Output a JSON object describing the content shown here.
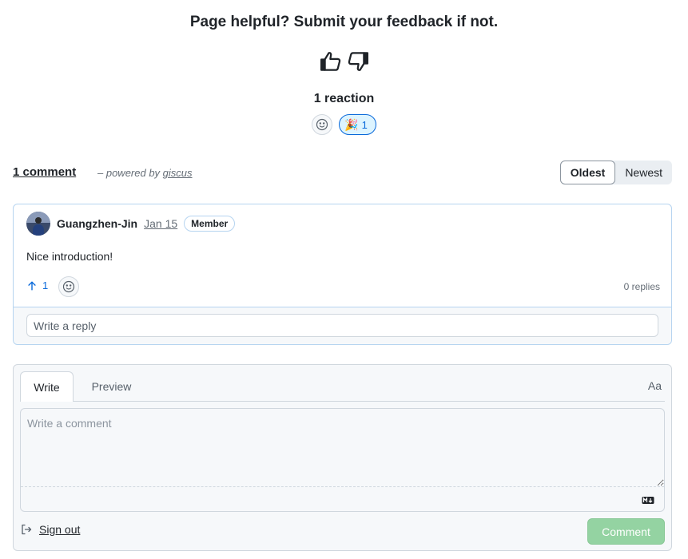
{
  "feedback": {
    "title": "Page helpful? Submit your feedback if not."
  },
  "reactions": {
    "count_label": "1 reaction",
    "tada_emoji": "🎉",
    "tada_count": "1"
  },
  "comments_header": {
    "count_label": "1 comment",
    "powered_prefix": " – powered by ",
    "powered_link": "giscus",
    "sort_options": [
      "Oldest",
      "Newest"
    ]
  },
  "comment": {
    "author": "Guangzhen-Jin",
    "date": "Jan 15",
    "badge": "Member",
    "body": "Nice introduction!",
    "upvotes": "1",
    "replies": "0 replies",
    "reply_placeholder": "Write a reply"
  },
  "editor": {
    "tabs": [
      "Write",
      "Preview"
    ],
    "font_toggle": "Aa",
    "placeholder": "Write a comment",
    "sign_out": "Sign out",
    "submit": "Comment"
  },
  "colors": {
    "accent": "#0969da",
    "submit_disabled": "#94d3a2"
  }
}
